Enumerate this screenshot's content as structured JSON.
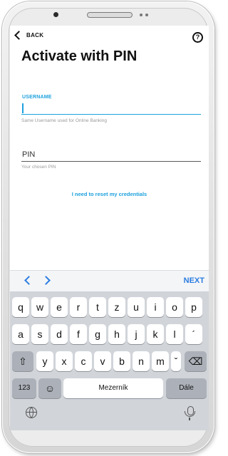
{
  "header": {
    "back_label": "BACK",
    "help_icon": "?",
    "title": "Activate with PIN"
  },
  "form": {
    "username": {
      "label": "USERNAME",
      "value": "",
      "hint": "Same Username used for Online Banking"
    },
    "pin": {
      "label": "PIN",
      "hint": "Your chosen PIN"
    },
    "reset_link": "I need to reset my credentials"
  },
  "toolbar": {
    "next_label": "NEXT"
  },
  "keyboard": {
    "row1": [
      "q",
      "w",
      "e",
      "r",
      "t",
      "z",
      "u",
      "i",
      "o",
      "p"
    ],
    "row2": [
      "a",
      "s",
      "d",
      "f",
      "g",
      "h",
      "j",
      "k",
      "l",
      "´"
    ],
    "row3": [
      "y",
      "x",
      "c",
      "v",
      "b",
      "n",
      "m",
      "ˇ"
    ],
    "shift": "⇧",
    "delete": "⌫",
    "numbers": "123",
    "emoji": "☺",
    "space": "Mezerník",
    "return": "Dále"
  },
  "colors": {
    "accent": "#1da1dd",
    "ios_blue": "#2b7de1"
  }
}
